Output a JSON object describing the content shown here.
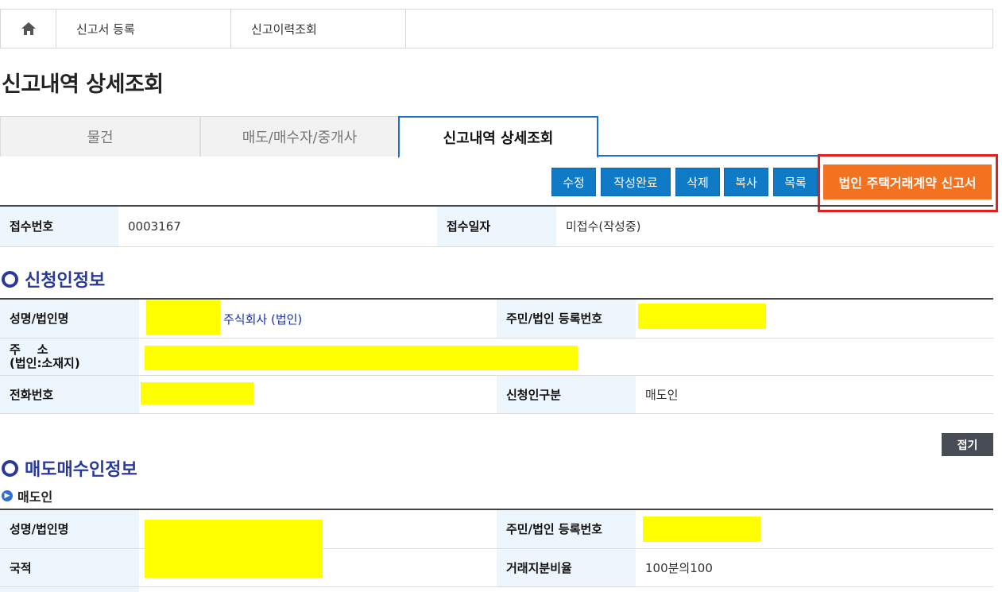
{
  "nav": {
    "items": [
      "신고서 등록",
      "신고이력조회"
    ]
  },
  "page_title": "신고내역 상세조회",
  "tabs": [
    {
      "label": "물건"
    },
    {
      "label": "매도/매수자/중개사"
    },
    {
      "label": "신고내역 상세조회"
    }
  ],
  "actions": {
    "edit": "수정",
    "complete": "작성완료",
    "delete": "삭제",
    "copy": "복사",
    "list": "목록",
    "corp_report": "법인 주택거래계약 신고서"
  },
  "receipt": {
    "number_label": "접수번호",
    "number_value": "0003167",
    "date_label": "접수일자",
    "date_value": "미접수(작성중)"
  },
  "applicant": {
    "title": "신청인정보",
    "name_label": "성명/법인명",
    "name_suffix": "주식회사 (법인)",
    "reg_label": "주민/법인 등록번호",
    "addr_label_1": "주    소",
    "addr_label_2": "(법인:소재지)",
    "phone_label": "전화번호",
    "type_label": "신청인구분",
    "type_value": "매도인"
  },
  "fold_label": "접기",
  "trade": {
    "title": "매도매수인정보",
    "sub_title": "매도인",
    "name_label": "성명/법인명",
    "reg_label": "주민/법인 등록번호",
    "nation_label": "국적",
    "ratio_label": "거래지분비율",
    "ratio_value": "100분의100"
  },
  "colors": {
    "primary_button": "#0f7ac6",
    "orange_button": "#f4711f",
    "highlight": "#e31e1e",
    "section_title": "#2a3a9c",
    "redaction": "#ffff00"
  }
}
